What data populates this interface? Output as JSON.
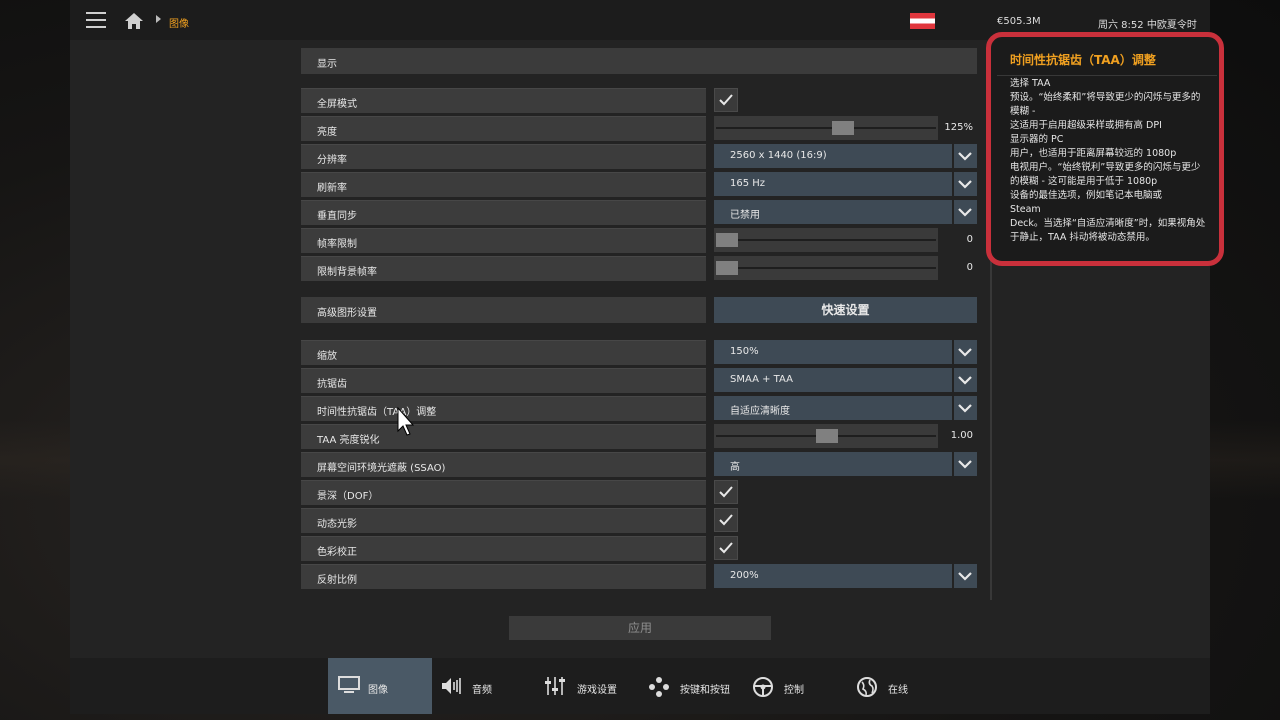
{
  "header": {
    "breadcrumb": "图像",
    "balance": "€505.3M",
    "datetime": "周六 8:52 中欧夏令时"
  },
  "sections": {
    "display": "显示",
    "advanced": "高级图形设置",
    "quick_settings": "快速设置"
  },
  "rows": [
    {
      "label": "全屏模式",
      "type": "checkbox",
      "checked": true
    },
    {
      "label": "亮度",
      "type": "slider",
      "value": "125%",
      "level": 0.58
    },
    {
      "label": "分辨率",
      "type": "select",
      "value": "2560 x 1440 (16:9)"
    },
    {
      "label": "刷新率",
      "type": "select",
      "value": "165 Hz"
    },
    {
      "label": "垂直同步",
      "type": "select",
      "value": "已禁用"
    },
    {
      "label": "帧率限制",
      "type": "slider",
      "value": "0",
      "level": 0.0
    },
    {
      "label": "限制背景帧率",
      "type": "slider",
      "value": "0",
      "level": 0.0
    }
  ],
  "advanced_rows": [
    {
      "label": "缩放",
      "type": "select",
      "value": "150%"
    },
    {
      "label": "抗锯齿",
      "type": "select",
      "value": "SMAA + TAA"
    },
    {
      "label": "时间性抗锯齿（TAA）调整",
      "type": "select",
      "value": "自适应清晰度"
    },
    {
      "label": "TAA 亮度锐化",
      "type": "slider",
      "value": "1.00",
      "level": 0.5
    },
    {
      "label": "屏幕空间环境光遮蔽 (SSAO)",
      "type": "select",
      "value": "高"
    },
    {
      "label": "景深（DOF）",
      "type": "checkbox",
      "checked": true
    },
    {
      "label": "动态光影",
      "type": "checkbox",
      "checked": true
    },
    {
      "label": "色彩校正",
      "type": "checkbox",
      "checked": true
    },
    {
      "label": "反射比例",
      "type": "select",
      "value": "200%"
    }
  ],
  "apply_label": "应用",
  "tooltip": {
    "title": "时间性抗锯齿（TAA）调整",
    "body": "选择 TAA\n预设。“始终柔和”将导致更少的闪烁与更多的模糊 -\n这适用于启用超级采样或拥有高 DPI\n显示器的 PC\n用户，也适用于距离屏幕较远的 1080p\n电视用户。“始终锐利”导致更多的闪烁与更少的模糊 - 这可能是用于低于 1080p\n设备的最佳选项，例如笔记本电脑或\nSteam\nDeck。当选择“自适应清晰度”时，如果视角处于静止，TAA 抖动将被动态禁用。"
  },
  "tabs": [
    {
      "label": "图像",
      "icon": "monitor-icon",
      "active": true
    },
    {
      "label": "音频",
      "icon": "speaker-icon",
      "active": false
    },
    {
      "label": "游戏设置",
      "icon": "sliders-icon",
      "active": false
    },
    {
      "label": "按键和按钮",
      "icon": "gamepad-icon",
      "active": false
    },
    {
      "label": "控制",
      "icon": "steering-wheel-icon",
      "active": false
    },
    {
      "label": "在线",
      "icon": "globe-icon",
      "active": false
    }
  ],
  "colors": {
    "accent": "#f0a020",
    "highlight_border": "#c9303b",
    "select_bg": "#3e4a55"
  }
}
